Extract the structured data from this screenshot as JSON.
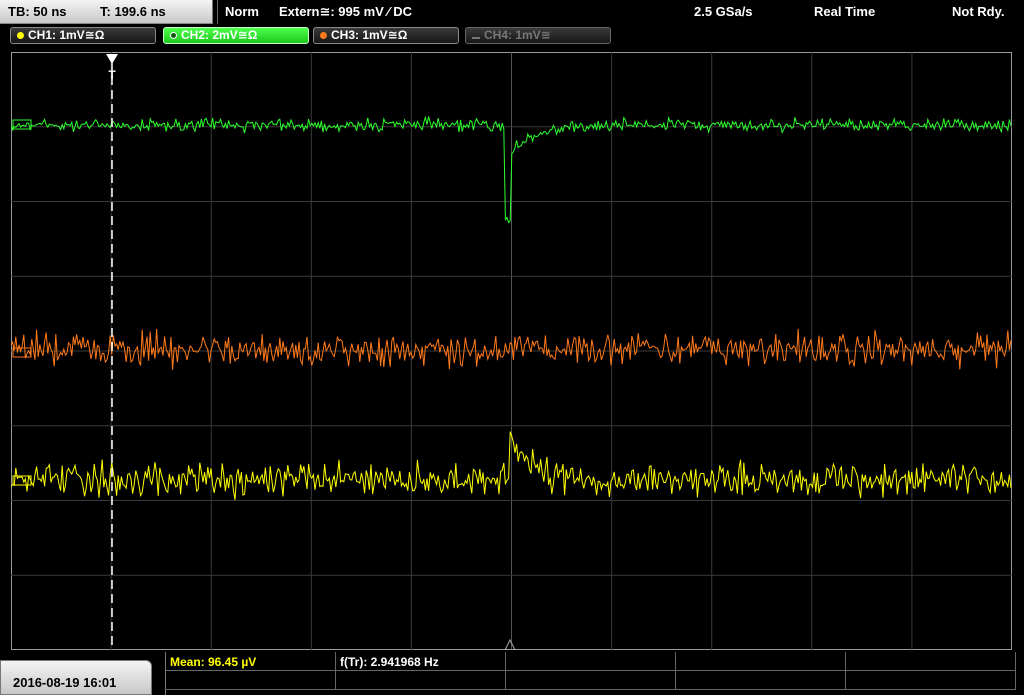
{
  "header": {
    "timebase": "TB: 50 ns",
    "trigger_time": "T: 199.6 ns",
    "mode": "Norm",
    "trigger_source": "Extern≅: 995 mV ⁄ DC",
    "sample_rate": "2.5 GSa/s",
    "acquisition": "Real Time",
    "status": "Not Rdy."
  },
  "channels": [
    {
      "label": "CH1: 1mV≅Ω",
      "color": "#ffff00",
      "active": false,
      "enabled": true
    },
    {
      "label": "CH2: 2mV≅Ω",
      "color": "#2cff2c",
      "active": true,
      "enabled": true
    },
    {
      "label": "CH3: 1mV≅Ω",
      "color": "#ff7a1a",
      "active": false,
      "enabled": true
    },
    {
      "label": "CH4: 1mV≅",
      "color": "#777777",
      "active": false,
      "enabled": false
    }
  ],
  "colors": {
    "ch1": "#ffff00",
    "ch2": "#2cff2c",
    "ch3": "#ff7a1a",
    "grid": "#3a3a3a",
    "trigger_line": "#ffffff"
  },
  "footer": {
    "datetime": "2016-08-19 16:01",
    "measurements": [
      {
        "label": "Mean: 96.45 µV",
        "color": "#ffff00"
      },
      {
        "label": "f(Tr): 2.941968 Hz",
        "color": "#ffffff"
      }
    ]
  }
}
